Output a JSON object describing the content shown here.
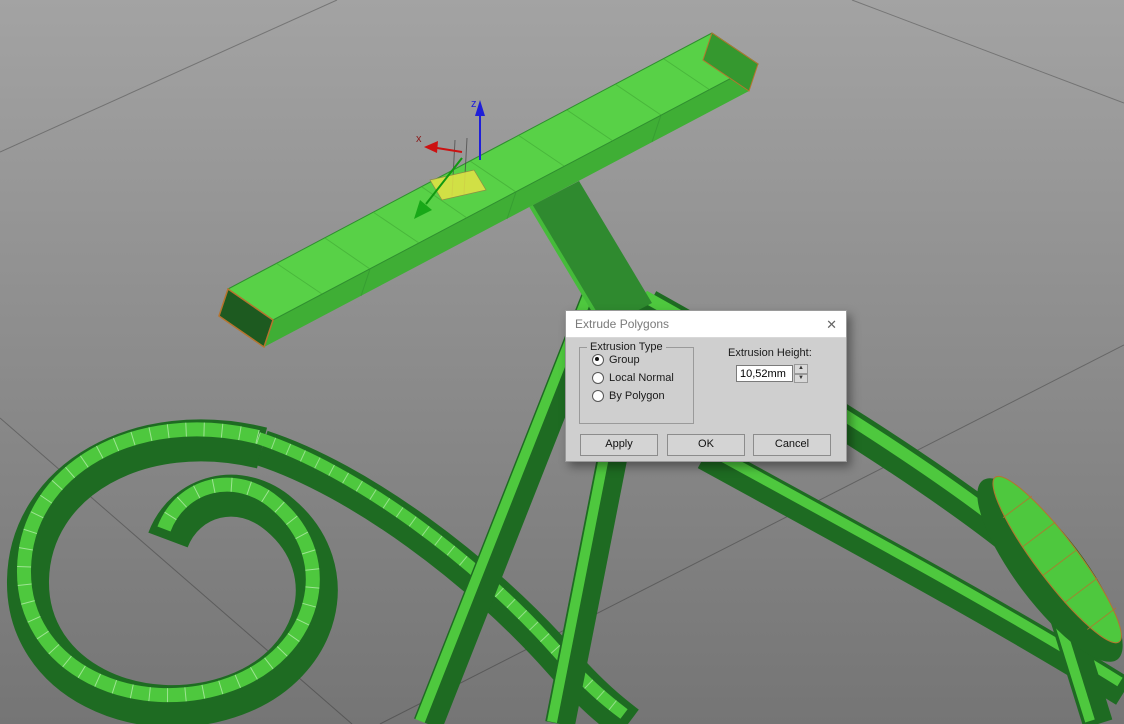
{
  "viewport": {
    "axis_labels": {
      "x": "x",
      "z": "z"
    },
    "colors": {
      "model_top": "#58d147",
      "model_side": "#1e6b22",
      "selection_edge": "#b5742e",
      "axis_x": "#cc1111",
      "axis_y": "#18a818",
      "axis_z": "#1f1fd8",
      "background_top": "#a3a3a3",
      "background_bottom": "#757575"
    }
  },
  "dialog": {
    "title": "Extrude Polygons",
    "close_label": "✕",
    "extrusion_type": {
      "legend": "Extrusion Type",
      "options": [
        {
          "label": "Group",
          "selected": true
        },
        {
          "label": "Local Normal",
          "selected": false
        },
        {
          "label": "By Polygon",
          "selected": false
        }
      ]
    },
    "height_label": "Extrusion Height:",
    "height_value": "10,52mm",
    "icons": {
      "spinner_up": "▲",
      "spinner_down": "▼"
    },
    "buttons": {
      "apply": "Apply",
      "ok": "OK",
      "cancel": "Cancel"
    }
  }
}
